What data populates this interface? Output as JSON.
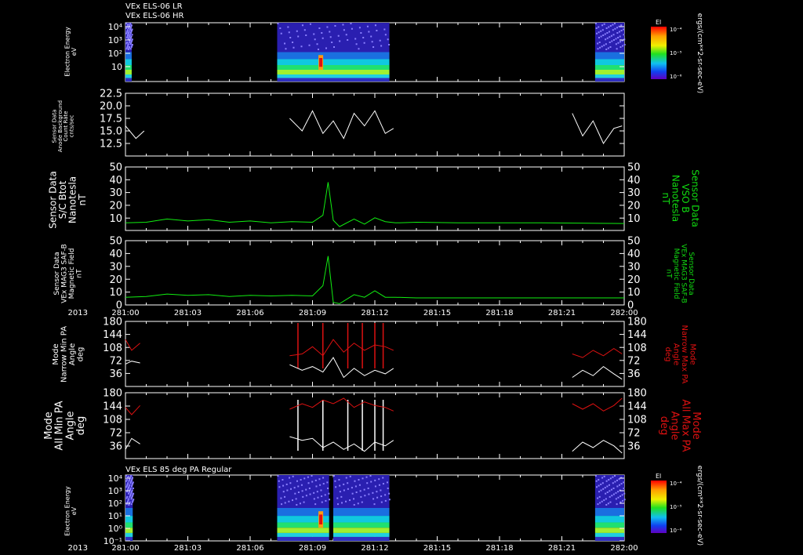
{
  "header": {
    "title_lr": "VEx ELS-06 LR",
    "title_hr": "VEx ELS-06 HR",
    "title_bottom": "VEx ELS 85 deg PA Regular"
  },
  "time_axis": {
    "year": "2013",
    "ticks": [
      "281:00",
      "281:03",
      "281:06",
      "281:09",
      "281:12",
      "281:15",
      "281:18",
      "281:21",
      "282:00"
    ]
  },
  "colorbar": {
    "label": "El",
    "ticks": [
      "10⁻⁴",
      "10⁻⁵",
      "10⁻⁶"
    ],
    "units": "ergs/(cm**2-sr-sec-eV)"
  },
  "panels": {
    "p1": {
      "ylabel": [
        "Electron Energy",
        "eV"
      ],
      "yticks": [
        "10⁴",
        "10³",
        "10²",
        "10"
      ]
    },
    "p2": {
      "ylabel": [
        "Sensor Data",
        "Anode Background",
        "Count Rate",
        "cnts/sec"
      ],
      "yticks": [
        "22.5",
        "20.0",
        "17.5",
        "15.0",
        "12.5"
      ]
    },
    "p3": {
      "ylabel": [
        "Sensor Data",
        "S/C Btot",
        "Nanotesla",
        "nT"
      ],
      "rlabel": [
        "Sensor Data",
        "VSO B",
        "Nanotesla",
        "nT"
      ],
      "yticks": [
        "50",
        "40",
        "30",
        "20",
        "10"
      ]
    },
    "p4": {
      "ylabel": [
        "Sensor Data",
        "VEx MAG3 SAF-B",
        "Magnetic Field",
        "nT"
      ],
      "rlabel": [
        "Sensor Data",
        "VEx MAG3 SAF-B",
        "Magnetic Field",
        "nT"
      ],
      "yticks": [
        "50",
        "40",
        "30",
        "20",
        "10",
        "0"
      ]
    },
    "p5": {
      "ylabel": [
        "Mode",
        "Narrow Min PA",
        "Angle",
        "deg"
      ],
      "rlabel": [
        "Mode",
        "Narrow Max PA",
        "Angle",
        "deg"
      ],
      "yticks": [
        "180",
        "144",
        "108",
        "72",
        "36"
      ]
    },
    "p6": {
      "ylabel": [
        "Mode",
        "All Min PA",
        "Angle",
        "deg"
      ],
      "rlabel": [
        "Mode",
        "All Max PA",
        "Angle",
        "deg"
      ],
      "yticks": [
        "180",
        "144",
        "108",
        "72",
        "36"
      ]
    },
    "p7": {
      "ylabel": [
        "Electron Energy",
        "eV"
      ],
      "yticks": [
        "10⁴",
        "10³",
        "10²",
        "10¹",
        "10⁰",
        "10⁻¹"
      ]
    }
  },
  "chart_data": {
    "type": "line",
    "x_unit": "DOY:HH",
    "x_range": [
      "281:00",
      "282:00"
    ],
    "series": [
      {
        "panel": "p2",
        "segments": [
          {
            "x": [
              0.0,
              0.5,
              0.9
            ],
            "y": [
              16.0,
              13.5,
              15.0
            ]
          },
          {
            "x": [
              7.9,
              8.5,
              9.0,
              9.5,
              10.0,
              10.5,
              11.0,
              11.5,
              12.0,
              12.5,
              12.9
            ],
            "y": [
              17.5,
              15.0,
              19.0,
              14.5,
              17.0,
              13.5,
              18.5,
              16.0,
              19.0,
              14.5,
              15.5
            ]
          },
          {
            "x": [
              21.5,
              22.0,
              22.5,
              23.0,
              23.5,
              23.9
            ],
            "y": [
              18.5,
              14.0,
              17.0,
              12.5,
              15.5,
              16.0
            ]
          }
        ]
      },
      {
        "panel": "p3",
        "segments": [
          {
            "x": [
              0.0,
              1.0,
              2.0,
              3.0,
              4.0,
              5.0,
              6.0,
              7.0,
              8.0,
              9.0,
              9.5,
              9.75,
              10.0,
              10.3,
              11.0,
              11.5,
              12.0,
              12.5,
              13.0,
              14.0,
              16.0,
              20.0,
              24.0
            ],
            "y": [
              6.0,
              6.5,
              9.0,
              7.5,
              8.5,
              6.5,
              7.5,
              6.0,
              7.0,
              6.5,
              12.0,
              38.0,
              8.0,
              3.0,
              9.0,
              5.0,
              10.0,
              7.0,
              6.0,
              6.5,
              6.0,
              6.0,
              5.5
            ]
          }
        ]
      },
      {
        "panel": "p4",
        "segments": [
          {
            "x": [
              0.0,
              1.0,
              2.0,
              3.0,
              4.0,
              5.0,
              6.0,
              7.0,
              8.0,
              9.0,
              9.5,
              9.75,
              10.0,
              10.3,
              11.0,
              11.5,
              12.0,
              12.5,
              13.0,
              14.0,
              16.0,
              20.0,
              24.0
            ],
            "y": [
              6.0,
              6.5,
              8.5,
              7.5,
              8.0,
              6.5,
              7.5,
              7.0,
              7.5,
              7.0,
              15.0,
              38.0,
              2.0,
              1.0,
              8.0,
              6.0,
              11.0,
              6.0,
              6.0,
              5.5,
              5.5,
              5.5,
              5.5
            ]
          }
        ]
      },
      {
        "panel": "p5_min",
        "segments": [
          {
            "x": [
              0.0,
              0.3,
              0.7
            ],
            "y": [
              62.0,
              70.0,
              65.0
            ]
          },
          {
            "x": [
              7.9,
              8.5,
              9.0,
              9.5,
              10.0,
              10.5,
              11.0,
              11.5,
              12.0,
              12.5,
              12.9
            ],
            "y": [
              60.0,
              45.0,
              55.0,
              40.0,
              80.0,
              25.0,
              50.0,
              30.0,
              45.0,
              35.0,
              50.0
            ]
          },
          {
            "x": [
              21.5,
              22.0,
              22.5,
              23.0,
              23.5,
              23.9
            ],
            "y": [
              25.0,
              45.0,
              30.0,
              55.0,
              35.0,
              20.0
            ]
          }
        ]
      },
      {
        "panel": "p5_max",
        "segments": [
          {
            "x": [
              0.0,
              0.3,
              0.7
            ],
            "y": [
              130.0,
              100.0,
              120.0
            ]
          },
          {
            "x": [
              7.9,
              8.5,
              9.0,
              9.5,
              10.0,
              10.5,
              11.0,
              11.5,
              12.0,
              12.5,
              12.9
            ],
            "y": [
              85.0,
              90.0,
              110.0,
              85.0,
              130.0,
              95.0,
              120.0,
              100.0,
              115.0,
              110.0,
              100.0
            ]
          },
          {
            "x": [
              21.5,
              22.0,
              22.5,
              23.0,
              23.5,
              23.9
            ],
            "y": [
              90.0,
              80.0,
              100.0,
              85.0,
              105.0,
              90.0
            ]
          }
        ]
      },
      {
        "panel": "p6_min",
        "segments": [
          {
            "x": [
              0.0,
              0.3,
              0.7
            ],
            "y": [
              25.0,
              55.0,
              40.0
            ]
          },
          {
            "x": [
              7.9,
              8.5,
              9.0,
              9.5,
              10.0,
              10.5,
              11.0,
              11.5,
              12.0,
              12.5,
              12.9
            ],
            "y": [
              60.0,
              50.0,
              55.0,
              30.0,
              45.0,
              25.0,
              40.0,
              20.0,
              45.0,
              35.0,
              50.0
            ]
          },
          {
            "x": [
              21.5,
              22.0,
              22.5,
              23.0,
              23.5,
              23.9
            ],
            "y": [
              20.0,
              45.0,
              30.0,
              50.0,
              35.0,
              15.0
            ]
          }
        ]
      },
      {
        "panel": "p6_max",
        "segments": [
          {
            "x": [
              0.0,
              0.3,
              0.7
            ],
            "y": [
              140.0,
              120.0,
              145.0
            ]
          },
          {
            "x": [
              7.9,
              8.5,
              9.0,
              9.5,
              10.0,
              10.5,
              11.0,
              11.5,
              12.0,
              12.5,
              12.9
            ],
            "y": [
              135.0,
              150.0,
              140.0,
              160.0,
              150.0,
              165.0,
              140.0,
              155.0,
              145.0,
              140.0,
              130.0
            ]
          },
          {
            "x": [
              21.5,
              22.0,
              22.5,
              23.0,
              23.5,
              23.9
            ],
            "y": [
              150.0,
              135.0,
              150.0,
              130.0,
              145.0,
              165.0
            ]
          }
        ]
      }
    ],
    "spikes_x": [
      8.3,
      9.5,
      10.7,
      11.4,
      12.0,
      12.4
    ]
  },
  "colors": {
    "background": "#000000",
    "axis": "#ffffff",
    "count_rate": "#ffffff",
    "field": "#11ee11",
    "green_label": "#11dd11",
    "max_pa": "#dd1111",
    "min_pa": "#ffffff"
  }
}
